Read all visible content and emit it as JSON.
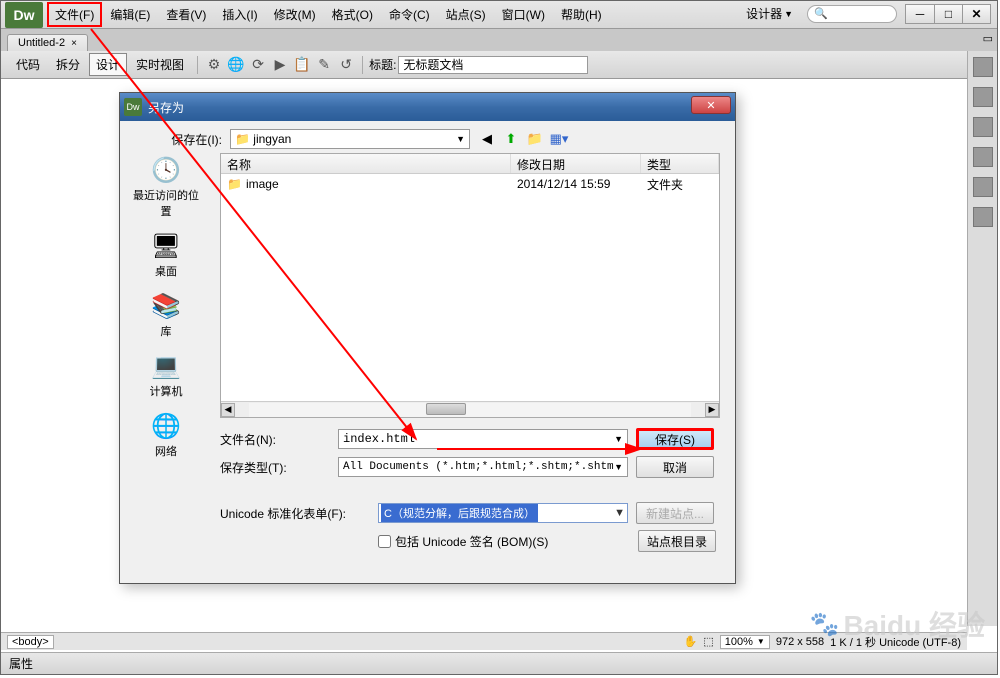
{
  "app": {
    "logo": "Dw"
  },
  "menus": [
    "文件(F)",
    "编辑(E)",
    "查看(V)",
    "插入(I)",
    "修改(M)",
    "格式(O)",
    "命令(C)",
    "站点(S)",
    "窗口(W)",
    "帮助(H)"
  ],
  "top_right": {
    "designer": "设计器",
    "search_placeholder": ""
  },
  "tab": {
    "name": "Untitled-2",
    "close": "×"
  },
  "toolbar": {
    "code": "代码",
    "split": "拆分",
    "design": "设计",
    "live": "实时视图",
    "title_label": "标题:",
    "title_value": "无标题文档"
  },
  "dialog": {
    "title": "另存为",
    "save_in": "保存在(I):",
    "folder": "jingyan",
    "cols": {
      "name": "名称",
      "date": "修改日期",
      "type": "类型"
    },
    "rows": [
      {
        "name": "image",
        "date": "2014/12/14 15:59",
        "type": "文件夹"
      }
    ],
    "sidebar": [
      {
        "label": "最近访问的位置",
        "icon": "🕓"
      },
      {
        "label": "桌面",
        "icon": "🖥"
      },
      {
        "label": "库",
        "icon": "📚"
      },
      {
        "label": "计算机",
        "icon": "💻"
      },
      {
        "label": "网络",
        "icon": "🌐"
      }
    ],
    "filename_label": "文件名(N):",
    "filename": "index.html",
    "filetype_label": "保存类型(T):",
    "filetype": "All Documents (*.htm;*.html;*.shtm;*.shtml;*.hta;",
    "unicode_label": "Unicode 标准化表单(F):",
    "unicode_value": "C（规范分解，后跟规范合成）",
    "include_bom": "包括 Unicode 签名 (BOM)(S)",
    "save_btn": "保存(S)",
    "cancel_btn": "取消",
    "newsite_btn": "新建站点...",
    "siteroot_btn": "站点根目录"
  },
  "status": {
    "tag": "<body>",
    "zoom": "100%",
    "dims": "972 x 558",
    "extra": "1 K / 1 秒 Unicode (UTF-8)"
  },
  "properties": "属性",
  "watermark": "Baidu 经验"
}
